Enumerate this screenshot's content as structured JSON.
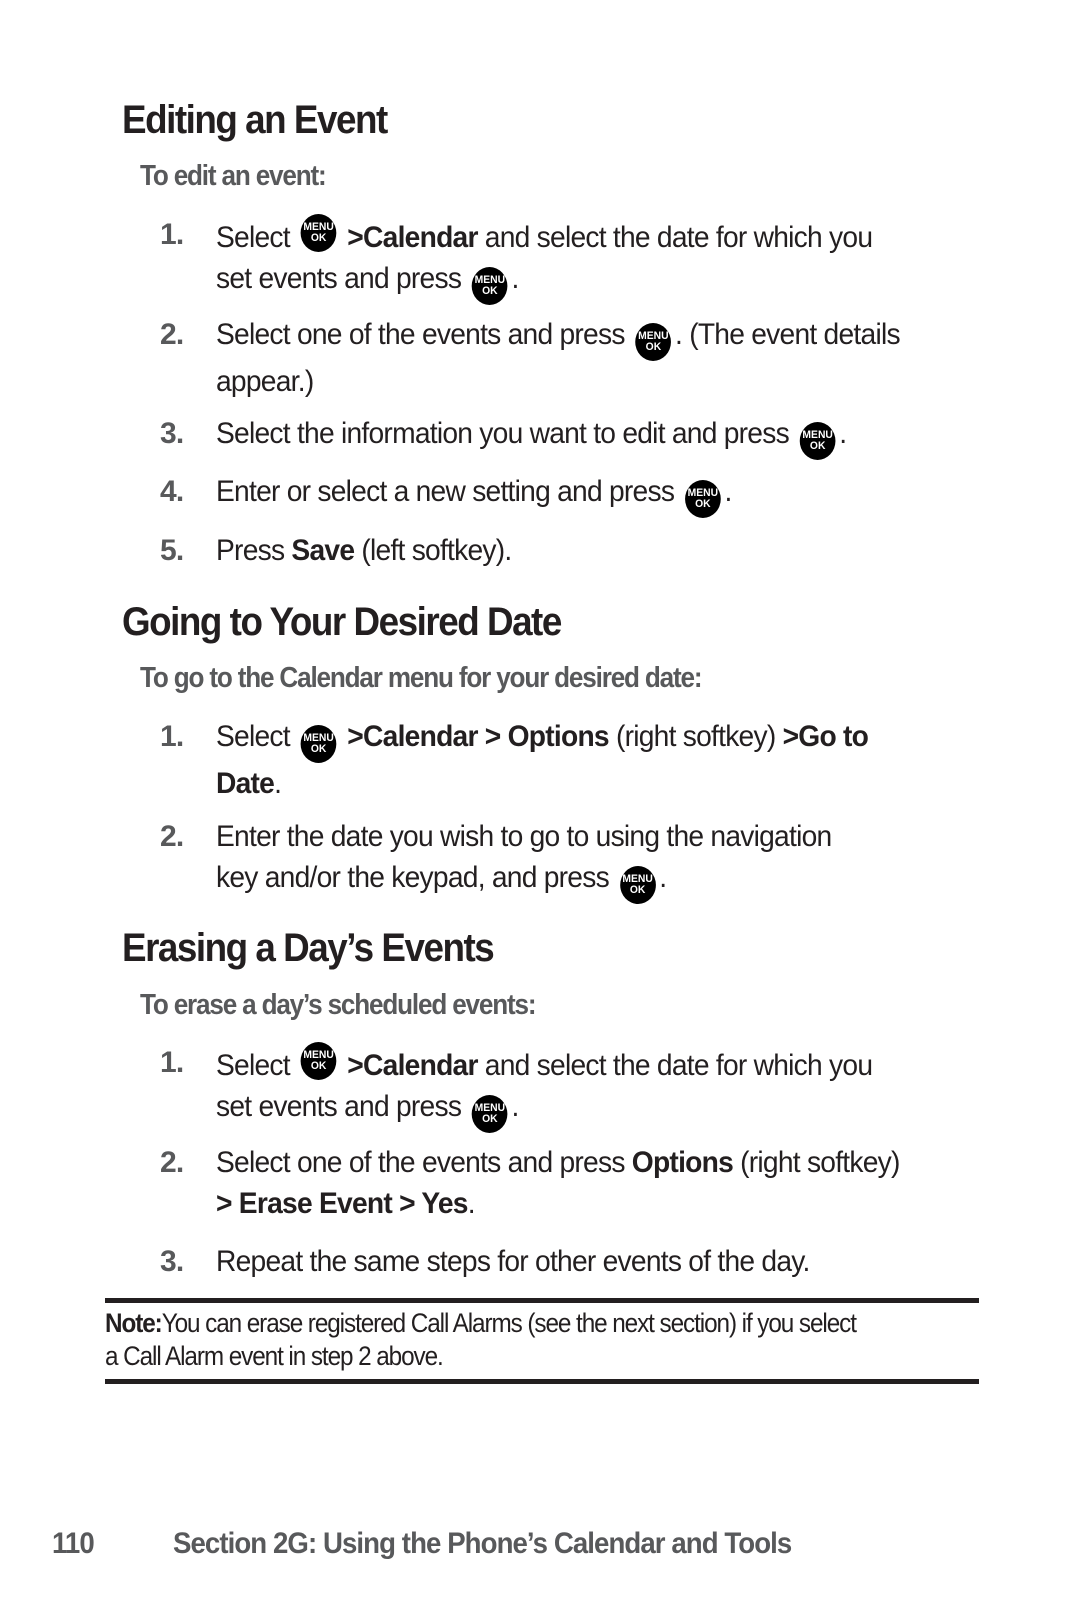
{
  "sections": [
    {
      "title": "Editing an Event",
      "subtitle": "To edit an event:",
      "steps": [
        {
          "num": "1.",
          "parts": {
            "a": "Select",
            "key": "MENU OK",
            "sep1": ">",
            "b1": "Calendar",
            "c": " and select the date for which you",
            "d": "set events and press",
            "end": "."
          }
        },
        {
          "num": "2.",
          "parts": {
            "a": "Select one of the events and press",
            "end": ". (The event details",
            "d": "appear.)"
          }
        },
        {
          "num": "3.",
          "parts": {
            "a": "Select the information you want to edit and press",
            "end": "."
          }
        },
        {
          "num": "4.",
          "parts": {
            "a": "Enter or select a new setting and press",
            "end": "."
          }
        },
        {
          "num": "5.",
          "parts": {
            "a": "Press ",
            "b1": "Save",
            "c": " (left softkey)."
          }
        }
      ]
    },
    {
      "title": "Going to Your Desired Date",
      "subtitle": "To go to the Calendar menu for your desired date:",
      "steps": [
        {
          "num": "1.",
          "parts": {
            "a": "Select",
            "sep1": ">",
            "b1": "Calendar",
            "sep2": " > ",
            "b2": "Options",
            "c": " (right softkey) ",
            "sep3": ">",
            "b3": "Go to",
            "b4": "Date",
            "end": "."
          }
        },
        {
          "num": "2.",
          "parts": {
            "a": "Enter the date you wish to go to  using the navigation",
            "d": "key and/or the keypad, and press",
            "end": "."
          }
        }
      ]
    },
    {
      "title": "Erasing a Day’s Events",
      "subtitle": "To erase a day’s scheduled events:",
      "steps": [
        {
          "num": "1.",
          "parts": {
            "a": "Select",
            "sep1": ">",
            "b1": "Calendar",
            "c": " and select the date for which you",
            "d": "set events and press",
            "end": "."
          }
        },
        {
          "num": "2.",
          "parts": {
            "a": "Select one of the events and press ",
            "b1": "Options",
            "c": " (right softkey)",
            "sep2": "> ",
            "b2": "Erase Event",
            "sep3": " > ",
            "b3": "Yes",
            "end": "."
          }
        },
        {
          "num": "3.",
          "parts": {
            "a": "Repeat the same steps for other events of the day."
          }
        }
      ]
    }
  ],
  "key_icon": {
    "line1": "MENU",
    "line2": "OK",
    "name": "menu-ok-key"
  },
  "note": {
    "label": "Note:",
    "line1": "You can erase registered Call Alarms (see the next section) if you select",
    "line2": "a Call Alarm event in step 2 above."
  },
  "footer": {
    "page_number": "110",
    "section": "Section 2G: Using the Phone’s Calendar and Tools"
  }
}
